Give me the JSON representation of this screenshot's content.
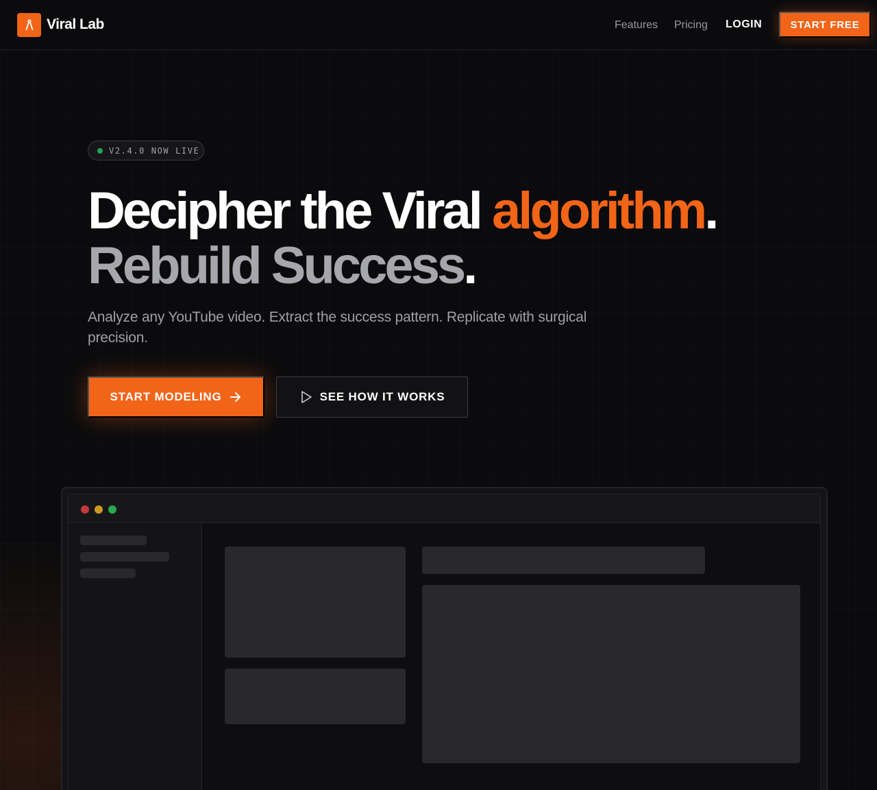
{
  "nav": {
    "brand": "Viral Lab",
    "logo_icon": "compass-icon",
    "links": [
      "Features",
      "Pricing"
    ],
    "login": "LOGIN",
    "cta": "START FREE"
  },
  "hero": {
    "badge": "V2.4.0 NOW LIVE",
    "headline_line1_main": "Decipher the Viral ",
    "headline_line1_accent": "algorithm",
    "headline_line1_dot": ".",
    "headline_line2_main": "Rebuild Success",
    "headline_line2_dot": ".",
    "subtitle": "Analyze any YouTube video. Extract the success pattern. Replicate with surgical precision.",
    "primary_button": "START MODELING",
    "primary_icon": "arrow-right-icon",
    "secondary_button": "SEE HOW IT WORKS",
    "secondary_icon": "play-icon"
  },
  "colors": {
    "accent": "#f26418",
    "background": "#0b0b0d",
    "status_live": "#22a65a"
  }
}
